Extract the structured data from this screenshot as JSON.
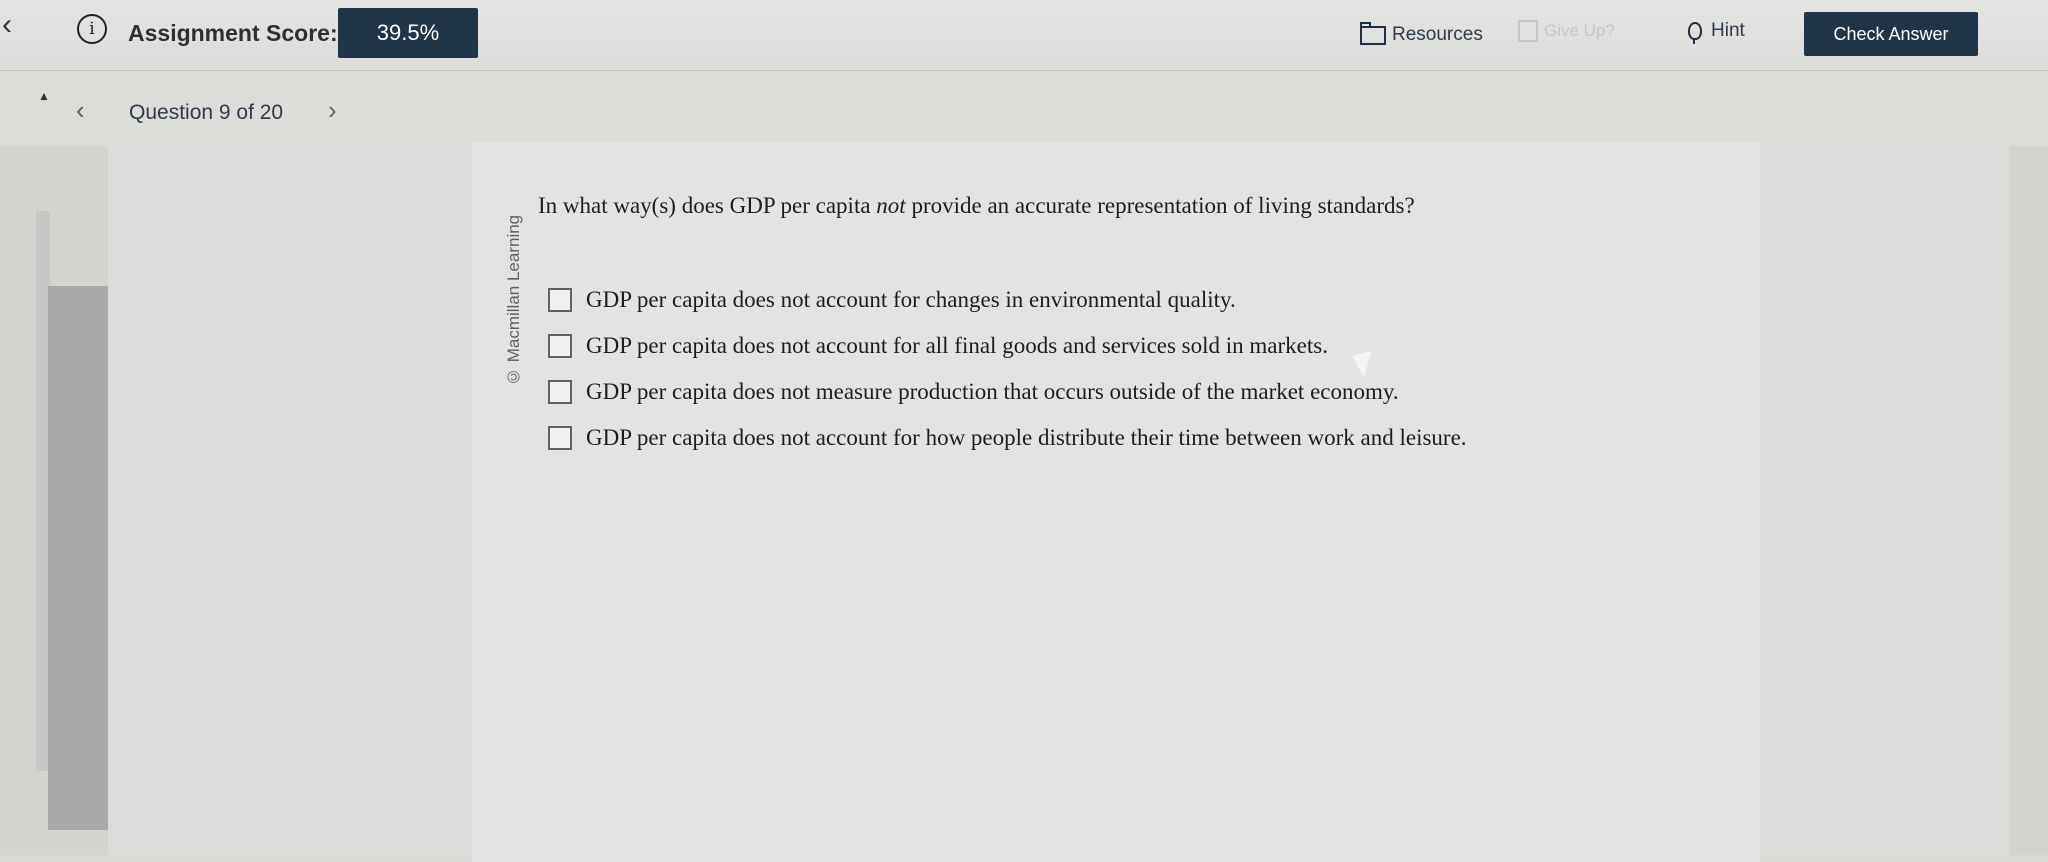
{
  "toolbar": {
    "back_glyph": "‹",
    "info_glyph": "i",
    "score_label": "Assignment Score:",
    "score_value": "39.5%",
    "resources_label": "Resources",
    "giveup_label": "Give Up?",
    "hint_label": "Hint",
    "check_answer_label": "Check Answer"
  },
  "navigation": {
    "collapse_glyph": "▲",
    "prev_glyph": "‹",
    "question_counter": "Question 9 of 20",
    "next_glyph": "›"
  },
  "question": {
    "copyright": "© Macmillan Learning",
    "prompt_before": "In what way(s) does GDP per capita ",
    "prompt_emphasis": "not",
    "prompt_after": " provide an accurate representation of living standards?",
    "options": [
      {
        "label": "GDP per capita does not account for changes in environmental quality.",
        "checked": false
      },
      {
        "label": "GDP per capita does not account for all final goods and services sold in markets.",
        "checked": false
      },
      {
        "label": "GDP per capita does not measure production that occurs outside of the market economy.",
        "checked": false
      },
      {
        "label": "GDP per capita does not account for how people distribute their time between work and leisure.",
        "checked": false
      }
    ]
  },
  "colors": {
    "accent_dark": "#1f3446",
    "background": "#dcdcda"
  }
}
